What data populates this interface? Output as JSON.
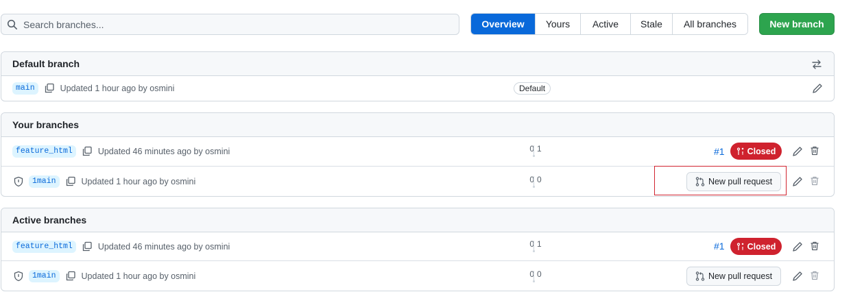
{
  "search": {
    "placeholder": "Search branches..."
  },
  "tabs": [
    {
      "label": "Overview",
      "active": true
    },
    {
      "label": "Yours",
      "active": false
    },
    {
      "label": "Active",
      "active": false
    },
    {
      "label": "Stale",
      "active": false
    },
    {
      "label": "All branches",
      "active": false
    }
  ],
  "new_branch_label": "New branch",
  "default_section": {
    "title": "Default branch",
    "branch": {
      "name": "main",
      "updated": "Updated 1 hour ago by osmini",
      "badge": "Default"
    }
  },
  "your_section": {
    "title": "Your branches",
    "rows": [
      {
        "name": "feature_html",
        "updated": "Updated 46 minutes ago by osmini",
        "behind": "0",
        "ahead": "1",
        "pr_number": "#1",
        "pr_state": "Closed"
      },
      {
        "name": "1main",
        "updated": "Updated 1 hour ago by osmini",
        "behind": "0",
        "ahead": "0",
        "new_pr_label": "New pull request"
      }
    ]
  },
  "active_section": {
    "title": "Active branches",
    "rows": [
      {
        "name": "feature_html",
        "updated": "Updated 46 minutes ago by osmini",
        "behind": "0",
        "ahead": "1",
        "pr_number": "#1",
        "pr_state": "Closed"
      },
      {
        "name": "1main",
        "updated": "Updated 1 hour ago by osmini",
        "behind": "0",
        "ahead": "0",
        "new_pr_label": "New pull request"
      }
    ]
  },
  "colors": {
    "primary": "#0969da",
    "success": "#2da44e",
    "danger": "#cf222e",
    "border": "#d0d7de"
  },
  "icons": [
    "search-icon",
    "switch-arrows-icon",
    "copy-icon",
    "pencil-icon",
    "trash-icon",
    "shield-icon",
    "pull-request-closed-icon",
    "pull-request-icon"
  ]
}
